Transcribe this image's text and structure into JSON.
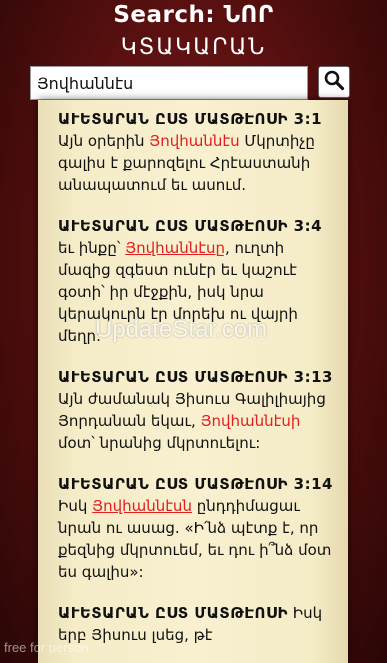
{
  "header": {
    "title_line1": "Search: ՆՈՐ",
    "title_line2": "ԿՏԱԿԱՐԱՆ"
  },
  "search": {
    "query": "Յովհաննէս",
    "button_icon": "search-icon"
  },
  "results": [
    {
      "ref": "ԱՒԵՏԱՐԱՆ ԸՍՏ ՄԱՏԹԷՈՍԻ 3:1",
      "before": " Այն օրերին ",
      "highlight": "Յովհաննէս",
      "after": " Մկրտիչը գալիս է քարոզելու Հրէաստանի անապատում եւ ասում."
    },
    {
      "ref": "ԱՒԵՏԱՐԱՆ ԸՍՏ ՄԱՏԹԷՈՍԻ 3:4",
      "before": " եւ ինքը՝ ",
      "highlight": "Յովհաննէսը",
      "after": ", ուղտի մազից զգեստ ունէր եւ կաշուէ գօտի՝ իր մէջքին, իսկ նրա կերակուրն էր մորեխ ու վայրի մեղր:"
    },
    {
      "ref": "ԱՒԵՏԱՐԱՆ ԸՍՏ ՄԱՏԹԷՈՍԻ 3:13",
      "before": " Այն ժամանակ Յիսուս Գալիլիայից Յորդանան եկաւ, ",
      "highlight": "Յովհաննէսի",
      "after": " մօտ՝ նրանից մկրտուելու:"
    },
    {
      "ref": "ԱՒԵՏԱՐԱՆ ԸՍՏ ՄԱՏԹԷՈՍԻ 3:14",
      "before": " Իսկ ",
      "highlight": "Յովհաննէսն",
      "after": " ընդդիմացաւ նրան ու ասաց. «Ի՛նձ պէտք է, որ քեզնից մկրտուեմ, եւ դու ի՞նձ մօտ ես գալիս»:"
    },
    {
      "ref": "ԱՒԵՏԱՐԱՆ ԸՍՏ ՄԱՏԹԷՈՍԻ",
      "before": " Իսկ երբ Յիսուս լսեց, թէ",
      "highlight": "",
      "after": ""
    }
  ],
  "watermark": "UpdateStar.com",
  "footer_note": "free for person"
}
